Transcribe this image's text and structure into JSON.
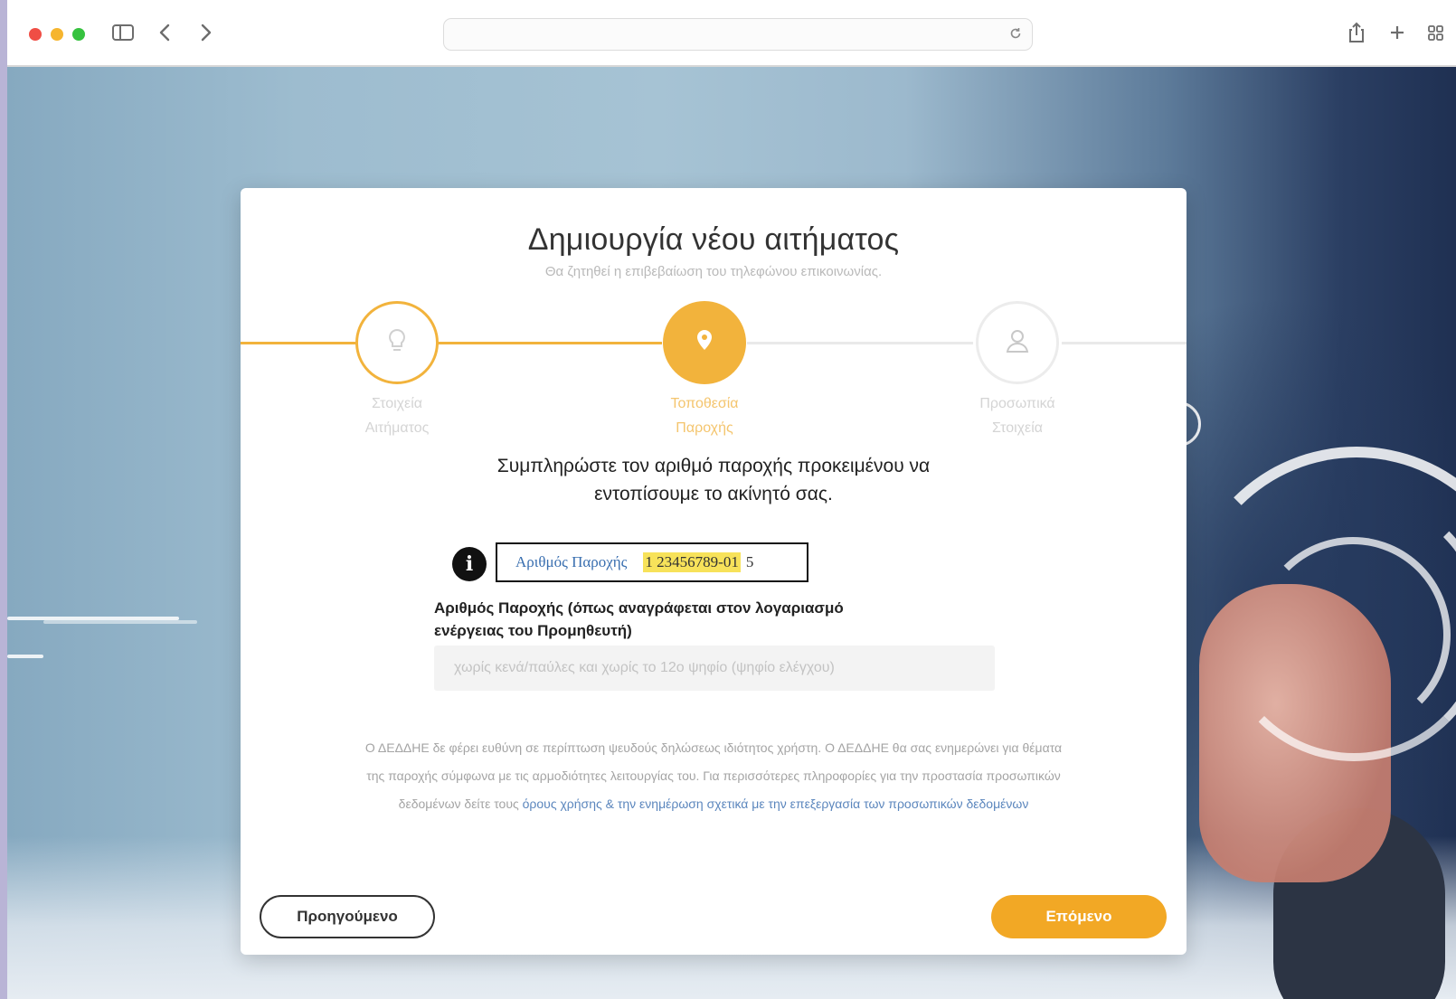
{
  "browser": {
    "icons": {
      "sidebar": "sidebar-icon",
      "back": "chevron-left-icon",
      "forward": "chevron-right-icon",
      "reload": "reload-icon",
      "share": "share-icon",
      "new_tab": "plus-icon",
      "tabs": "grid-icon"
    },
    "address": ""
  },
  "modal": {
    "title": "Δημιουργία νέου αιτήματος",
    "subtitle": "Θα ζητηθεί η επιβεβαίωση του τηλεφώνου επικοινωνίας.",
    "steps": [
      {
        "line1": "Στοιχεία",
        "line2": "Αιτήματος",
        "icon": "lightbulb-icon",
        "state": "done"
      },
      {
        "line1": "Τοποθεσία",
        "line2": "Παροχής",
        "icon": "location-pin-icon",
        "state": "active"
      },
      {
        "line1": "Προσωπικά",
        "line2": "Στοιχεία",
        "icon": "user-icon",
        "state": "pending"
      }
    ],
    "instruction_line1": "Συμπληρώστε τον αριθμό παροχής προκειμένου να",
    "instruction_line2": "εντοπίσουμε το ακίνητό σας.",
    "example": {
      "label": "Αριθμός Παροχής",
      "number": "1 23456789-01",
      "check_digit": "5"
    },
    "field": {
      "label_line1": "Αριθμός Παροχής (όπως αναγράφεται στον λογαριασμό",
      "label_line2": "ενέργειας του Προμηθευτή)",
      "value": "",
      "placeholder": "χωρίς κενά/παύλες και χωρίς το 12ο ψηφίο (ψηφίο ελέγχου)"
    },
    "disclaimer": {
      "text": "Ο ΔΕΔΔΗΕ δε φέρει ευθύνη σε περίπτωση ψευδούς δηλώσεως ιδιότητος χρήστη. Ο ΔΕΔΔΗΕ θα σας ενημερώνει για θέματα της παροχής σύμφωνα με τις αρμοδιότητες λειτουργίας του. Για περισσότερες πληροφορίες για την προστασία προσωπικών δεδομένων δείτε τους ",
      "link": "όρους χρήσης & την ενημέρωση σχετικά με την επεξεργασία των προσωπικών δεδομένων"
    },
    "buttons": {
      "previous": "Προηγούμενο",
      "next": "Επόμενο"
    }
  },
  "colors": {
    "accent": "#f2a825",
    "step_line_done": "#f2b33c",
    "link": "#5b86bd"
  }
}
